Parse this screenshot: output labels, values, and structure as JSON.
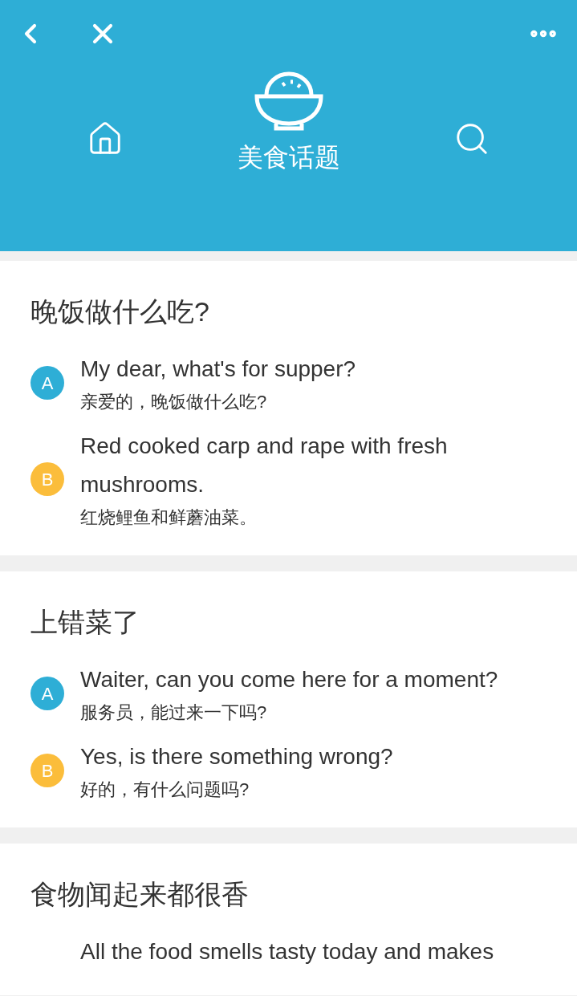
{
  "header": {
    "title": "美食话题"
  },
  "topics": [
    {
      "title": "晚饭做什么吃?",
      "lines": [
        {
          "speaker": "A",
          "color": "#2eaed6",
          "english": "My dear, what's for supper?",
          "chinese": "亲爱的，晚饭做什么吃?"
        },
        {
          "speaker": "B",
          "color": "#fbbd3b",
          "english": "Red cooked carp and rape with fresh mushrooms.",
          "chinese": "红烧鲤鱼和鲜蘑油菜。"
        }
      ]
    },
    {
      "title": "上错菜了",
      "lines": [
        {
          "speaker": "A",
          "color": "#2eaed6",
          "english": "Waiter, can you come here for a moment?",
          "chinese": "服务员，能过来一下吗?"
        },
        {
          "speaker": "B",
          "color": "#fbbd3b",
          "english": "Yes, is there something wrong?",
          "chinese": "好的，有什么问题吗?"
        }
      ]
    },
    {
      "title": "食物闻起来都很香",
      "lines": [
        {
          "english": "All the food smells tasty today and makes"
        }
      ]
    }
  ]
}
